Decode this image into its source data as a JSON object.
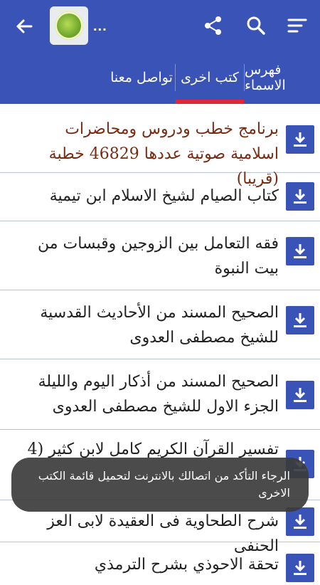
{
  "appbar": {
    "title": "...",
    "icons": [
      "back-arrow-icon",
      "app-logo",
      "share-icon",
      "search-icon",
      "sort-menu-icon"
    ],
    "color": "#3a53b6"
  },
  "tabs": [
    {
      "label": "فهرس الاسماء",
      "active": false
    },
    {
      "label": "كتب اخرى",
      "active": true
    },
    {
      "label": "تواصل معنا",
      "active": false
    }
  ],
  "list": {
    "items": [
      {
        "title": "برنامج خطب ودروس ومحاضرات اسلامية صوتية عددها 46829 خطبة (قريبا)"
      },
      {
        "title": "كتاب الصيام لشيخ الاسلام ابن تيمية"
      },
      {
        "title": "فقه التعامل بين الزوجين وقبسات من بيت النبوة"
      },
      {
        "title": "الصحيح المسند من الأحاديث القدسية للشيخ مصطفى العدوى"
      },
      {
        "title": "الصحيح المسند من أذكار اليوم والليلة الجزء الاول للشيخ مصطفى العدوى"
      },
      {
        "title": "تفسير القرآن الكريم كامل لابن كثير (4"
      },
      {
        "title": "شرح الطحاوية فى العقيدة لابى العز الحنفى"
      },
      {
        "title": "تحقة الاحوذي بشرح الترمذي"
      }
    ],
    "download_icon": "download-icon"
  },
  "toast": {
    "message": "الرجاء التأكد من اتصالك بالانترنت لتحميل قائمة الكتب الاخرى"
  }
}
